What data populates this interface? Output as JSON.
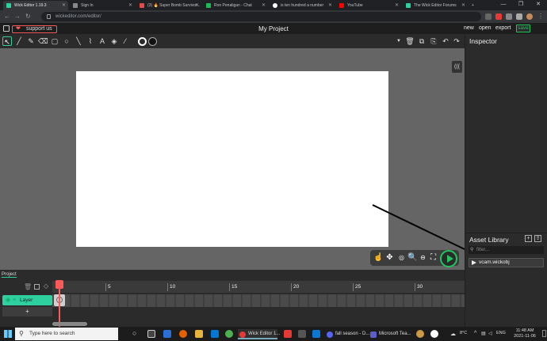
{
  "browser": {
    "tabs": [
      {
        "title": "Wick Editor 1.19.3",
        "color": "#2fd0a0",
        "active": true
      },
      {
        "title": "Sign In",
        "color": "#888888"
      },
      {
        "title": "(3) 🔥 Super Bomb Survivor...",
        "color": "#e54b4b"
      },
      {
        "title": "Ron Penaligan - Chat",
        "color": "#1db954"
      },
      {
        "title": "is ten hundred a number",
        "color": "#ffffff"
      },
      {
        "title": "YouTube",
        "color": "#ff0000"
      },
      {
        "title": "The Wick Editor Forums",
        "color": "#2fd0a0"
      }
    ],
    "url": "wickeditor.com/editor/",
    "window_controls": [
      "—",
      "❐",
      "✕"
    ]
  },
  "editor": {
    "support_label": "support us",
    "project_title": "My Project",
    "menu": {
      "new": "new",
      "open": "open",
      "export": "export",
      "save": "save"
    },
    "accent": "#2fd0a0",
    "save_color": "#21c45f"
  },
  "inspector": {
    "title": "Inspector"
  },
  "assets": {
    "title": "Asset Library",
    "filter_placeholder": "filter...",
    "items": [
      "vcam.wickobj"
    ]
  },
  "timeline": {
    "tab_label": "Project",
    "layer_name": "Layer",
    "add_layer": "+",
    "ruler_ticks": [
      "5",
      "10",
      "15",
      "20",
      "25",
      "30"
    ]
  },
  "taskbar": {
    "search_placeholder": "Type here to search",
    "apps": [
      "Wick Editor 1...",
      "fall season - D...",
      "Microsoft Tea..."
    ],
    "temperature": "8°C",
    "language": "ENG",
    "time": "11:48 AM",
    "date": "2021-11-06"
  }
}
